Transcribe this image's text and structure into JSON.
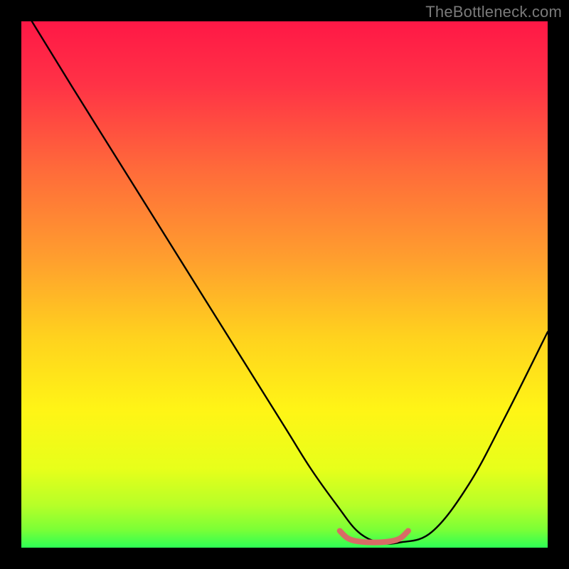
{
  "watermark": "TheBottleneck.com",
  "colors": {
    "page_bg": "#000000",
    "curve": "#000000",
    "accent_red": "#d86b66",
    "gradient_stops": [
      {
        "offset": 0.0,
        "color": "#ff1846"
      },
      {
        "offset": 0.12,
        "color": "#ff3246"
      },
      {
        "offset": 0.28,
        "color": "#ff6a3a"
      },
      {
        "offset": 0.45,
        "color": "#ff9e2e"
      },
      {
        "offset": 0.6,
        "color": "#ffd21e"
      },
      {
        "offset": 0.74,
        "color": "#fff516"
      },
      {
        "offset": 0.85,
        "color": "#e7ff1a"
      },
      {
        "offset": 0.92,
        "color": "#b6ff28"
      },
      {
        "offset": 0.965,
        "color": "#7cff36"
      },
      {
        "offset": 1.0,
        "color": "#2dff55"
      }
    ]
  },
  "chart_data": {
    "type": "line",
    "title": "",
    "xlabel": "",
    "ylabel": "",
    "xlim": [
      0,
      100
    ],
    "ylim": [
      0,
      100
    ],
    "grid": false,
    "series": [
      {
        "name": "main-curve",
        "x": [
          2,
          10,
          20,
          30,
          40,
          50,
          55,
          60,
          64,
          68,
          72,
          78,
          85,
          92,
          100
        ],
        "y": [
          100,
          87,
          71,
          55,
          39,
          23,
          15,
          8,
          3,
          1,
          1,
          3,
          12,
          25,
          41
        ]
      }
    ],
    "accent_segment": {
      "note": "short red curved segment near the trough",
      "x": [
        60.5,
        62,
        64,
        67,
        70,
        72,
        73.5
      ],
      "y": [
        3.2,
        1.8,
        1.2,
        1.0,
        1.2,
        1.8,
        3.2
      ]
    }
  }
}
